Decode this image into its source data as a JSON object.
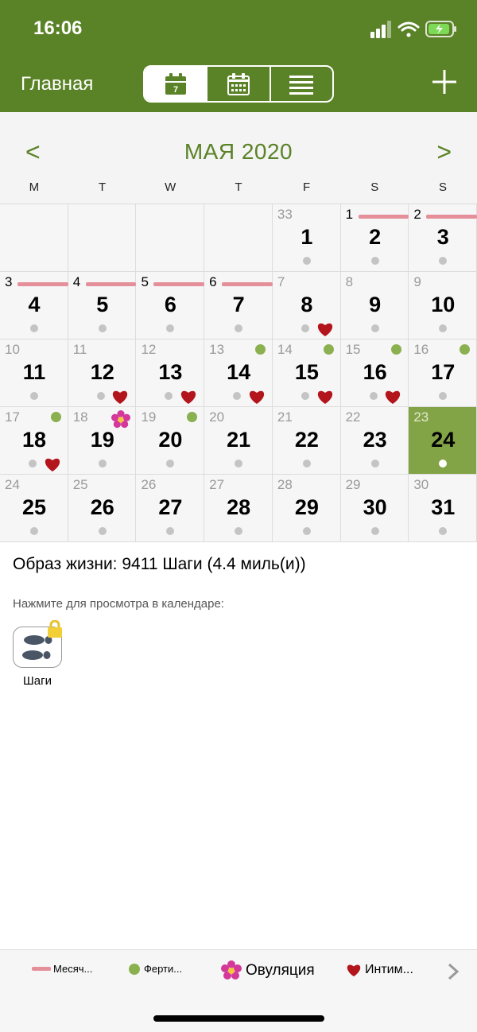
{
  "status": {
    "time": "16:06"
  },
  "header": {
    "title": "Главная"
  },
  "calendar": {
    "month_title": "МАЯ 2020",
    "prev_label": "<",
    "next_label": ">",
    "weekdays": [
      "M",
      "T",
      "W",
      "T",
      "F",
      "S",
      "S"
    ],
    "today": "24",
    "days": [
      {
        "day": "1",
        "cycle": "33",
        "period": false,
        "fertile": false,
        "intim": false,
        "ovulation": false
      },
      {
        "day": "2",
        "cycle": "1",
        "period": true,
        "fertile": false,
        "intim": false,
        "ovulation": false
      },
      {
        "day": "3",
        "cycle": "2",
        "period": true,
        "fertile": false,
        "intim": false,
        "ovulation": false
      },
      {
        "day": "4",
        "cycle": "3",
        "period": true,
        "fertile": false,
        "intim": false,
        "ovulation": false
      },
      {
        "day": "5",
        "cycle": "4",
        "period": true,
        "fertile": false,
        "intim": false,
        "ovulation": false
      },
      {
        "day": "6",
        "cycle": "5",
        "period": true,
        "fertile": false,
        "intim": false,
        "ovulation": false
      },
      {
        "day": "7",
        "cycle": "6",
        "period": true,
        "fertile": false,
        "intim": false,
        "ovulation": false
      },
      {
        "day": "8",
        "cycle": "7",
        "period": false,
        "fertile": false,
        "intim": true,
        "ovulation": false
      },
      {
        "day": "9",
        "cycle": "8",
        "period": false,
        "fertile": false,
        "intim": false,
        "ovulation": false
      },
      {
        "day": "10",
        "cycle": "9",
        "period": false,
        "fertile": false,
        "intim": false,
        "ovulation": false
      },
      {
        "day": "11",
        "cycle": "10",
        "period": false,
        "fertile": false,
        "intim": false,
        "ovulation": false
      },
      {
        "day": "12",
        "cycle": "11",
        "period": false,
        "fertile": false,
        "intim": true,
        "ovulation": false
      },
      {
        "day": "13",
        "cycle": "12",
        "period": false,
        "fertile": false,
        "intim": true,
        "ovulation": false
      },
      {
        "day": "14",
        "cycle": "13",
        "period": false,
        "fertile": true,
        "intim": true,
        "ovulation": false
      },
      {
        "day": "15",
        "cycle": "14",
        "period": false,
        "fertile": true,
        "intim": true,
        "ovulation": false
      },
      {
        "day": "16",
        "cycle": "15",
        "period": false,
        "fertile": true,
        "intim": true,
        "ovulation": false
      },
      {
        "day": "17",
        "cycle": "16",
        "period": false,
        "fertile": true,
        "intim": false,
        "ovulation": false
      },
      {
        "day": "18",
        "cycle": "17",
        "period": false,
        "fertile": true,
        "intim": true,
        "ovulation": false
      },
      {
        "day": "19",
        "cycle": "18",
        "period": false,
        "fertile": false,
        "intim": false,
        "ovulation": true
      },
      {
        "day": "20",
        "cycle": "19",
        "period": false,
        "fertile": true,
        "intim": false,
        "ovulation": false
      },
      {
        "day": "21",
        "cycle": "20",
        "period": false,
        "fertile": false,
        "intim": false,
        "ovulation": false
      },
      {
        "day": "22",
        "cycle": "21",
        "period": false,
        "fertile": false,
        "intim": false,
        "ovulation": false
      },
      {
        "day": "23",
        "cycle": "22",
        "period": false,
        "fertile": false,
        "intim": false,
        "ovulation": false
      },
      {
        "day": "24",
        "cycle": "23",
        "period": false,
        "fertile": false,
        "intim": false,
        "ovulation": false
      },
      {
        "day": "25",
        "cycle": "24",
        "period": false,
        "fertile": false,
        "intim": false,
        "ovulation": false
      },
      {
        "day": "26",
        "cycle": "25",
        "period": false,
        "fertile": false,
        "intim": false,
        "ovulation": false
      },
      {
        "day": "27",
        "cycle": "26",
        "period": false,
        "fertile": false,
        "intim": false,
        "ovulation": false
      },
      {
        "day": "28",
        "cycle": "27",
        "period": false,
        "fertile": false,
        "intim": false,
        "ovulation": false
      },
      {
        "day": "29",
        "cycle": "28",
        "period": false,
        "fertile": false,
        "intim": false,
        "ovulation": false
      },
      {
        "day": "30",
        "cycle": "29",
        "period": false,
        "fertile": false,
        "intim": false,
        "ovulation": false
      },
      {
        "day": "31",
        "cycle": "30",
        "period": false,
        "fertile": false,
        "intim": false,
        "ovulation": false
      }
    ]
  },
  "info": {
    "lifestyle": "Образ жизни: 9411 Шаги (4.4 миль(и))",
    "hint": "Нажмите для просмотра в календаре:",
    "steps_label": "Шаги"
  },
  "legend": {
    "period": "Месяч...",
    "fertile": "Ферти...",
    "ovulation": "Овуляция",
    "intim": "Интим..."
  },
  "icons": {
    "calendar_week": "calendar-week-icon",
    "calendar_month": "calendar-month-icon",
    "list": "list-icon",
    "add": "plus-icon",
    "steps": "footprints-icon",
    "lock": "lock-icon",
    "heart": "heart-icon",
    "flower": "flower-icon"
  },
  "colors": {
    "brand_green": "#5a8226",
    "today_green": "#83a347",
    "period_pink": "#e48f9a",
    "fertile_green": "#8ab04f",
    "heart_red": "#b3151c"
  }
}
